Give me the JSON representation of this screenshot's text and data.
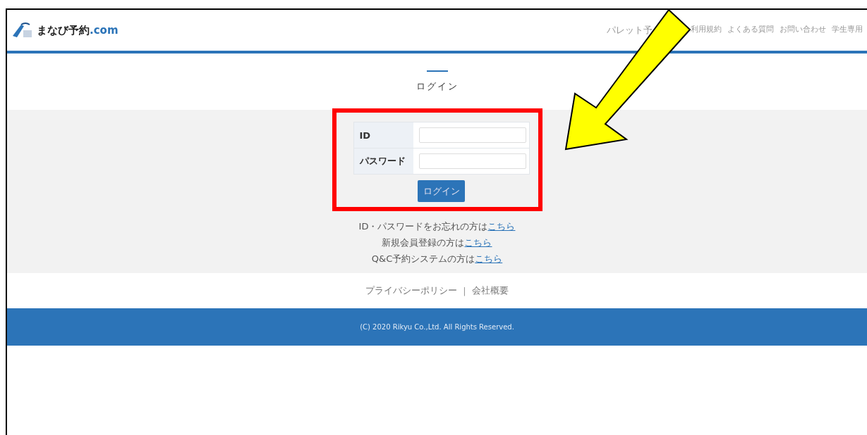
{
  "header": {
    "logo_text": "まなび予約",
    "logo_suffix": ".com",
    "nav": [
      "パレット予",
      "利用規約",
      "よくある質問",
      "お問い合わせ",
      "学生専用"
    ]
  },
  "login": {
    "title": "ログイン",
    "fields": [
      {
        "label": "ID"
      },
      {
        "label": "パスワード"
      }
    ],
    "button": "ログイン"
  },
  "links": [
    {
      "text": "ID・パスワードをお忘れの方は",
      "link": "こちら"
    },
    {
      "text": "新規会員登録の方は",
      "link": "こちら"
    },
    {
      "text": "Q&C予約システムの方は",
      "link": "こちら"
    }
  ],
  "footer_links": [
    "プライバシーポリシー",
    "会社概要"
  ],
  "footer_separator": "|",
  "copyright": "(C) 2020 Rikyu Co.,Ltd. All Rights Reserved.",
  "annotations": [
    {
      "kind": "box",
      "color": "#ff0000"
    },
    {
      "kind": "arrow",
      "color": "#ffff00"
    }
  ]
}
